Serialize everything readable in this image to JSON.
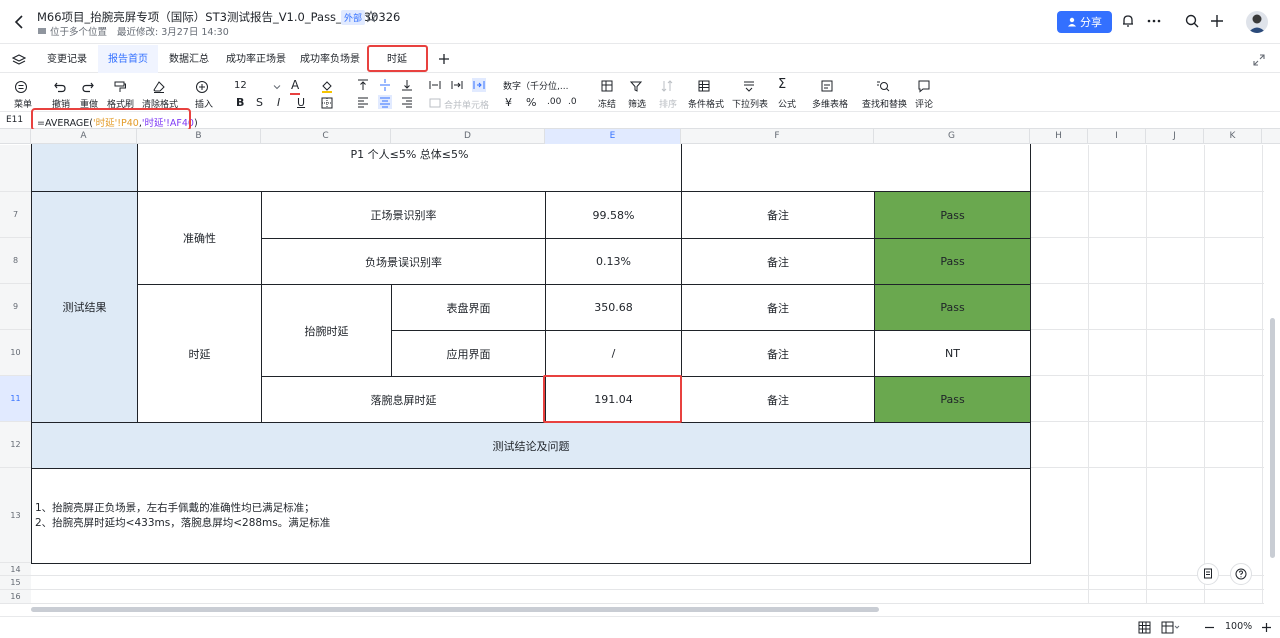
{
  "header": {
    "title": "M66项目_抬腕亮屏专项（国际）ST3测试报告_V1.0_Pass_20230326",
    "badge": "外部",
    "location": "位于多个位置",
    "modified": "最近修改: 3月27日 14:30",
    "share_label": "分享"
  },
  "tabs": [
    "变更记录",
    "报告首页",
    "数据汇总",
    "成功率正场景",
    "成功率负场景",
    "时延"
  ],
  "active_tab": "报告首页",
  "toolbar": {
    "menu": "菜单",
    "undo": "撤销",
    "redo": "重做",
    "format_painter": "格式刷",
    "clear_format": "清除格式",
    "insert": "插入",
    "font_size": "12",
    "merge": "合并单元格",
    "number_format": "数字（千分位,...",
    "freeze": "冻结",
    "filter": "筛选",
    "sort": "排序",
    "cond_format": "条件格式",
    "dropdown": "下拉列表",
    "formula": "公式",
    "multi_dim": "多维表格",
    "find_replace": "查找和替换",
    "comment": "评论"
  },
  "formula_bar": {
    "cell": "E11",
    "prefix": "=AVERAGE(",
    "arg1": "'时延'!P40",
    "sep": ",",
    "arg2": "'时延'!AF40",
    "suffix": ")"
  },
  "columns": [
    "A",
    "B",
    "C",
    "D",
    "E",
    "F",
    "G",
    "H",
    "I",
    "J",
    "K"
  ],
  "rows": [
    "7",
    "8",
    "9",
    "10",
    "11",
    "12",
    "13",
    "14",
    "15",
    "16"
  ],
  "cells": {
    "top_note": "P1 个人≤5% 总体≤5%",
    "test_result": "测试结果",
    "accuracy": "准确性",
    "latency": "时延",
    "wrist_latency": "抬腕时延",
    "r7_item": "正场景识别率",
    "r7_value": "99.58%",
    "r8_item": "负场景误识别率",
    "r8_value": "0.13%",
    "r9_item": "表盘界面",
    "r9_value": "350.68",
    "r10_item": "应用界面",
    "r10_value": "/",
    "r11_item": "落腕息屏时延",
    "r11_value": "191.04",
    "remark": "备注",
    "pass": "Pass",
    "nt": "NT",
    "conclusion_header": "测试结论及问题",
    "conclusion_line1": "1、抬腕亮屏正负场景，左右手佩戴的准确性均已满足标准；",
    "conclusion_line2": "2、抬腕亮屏时延均<433ms，落腕息屏均<288ms。满足标准"
  },
  "zoom": "100%",
  "colors": {
    "pass": "#6aa84f",
    "header_blue": "#deeaf6",
    "accent": "#3370ff",
    "highlight": "#e8413f"
  }
}
